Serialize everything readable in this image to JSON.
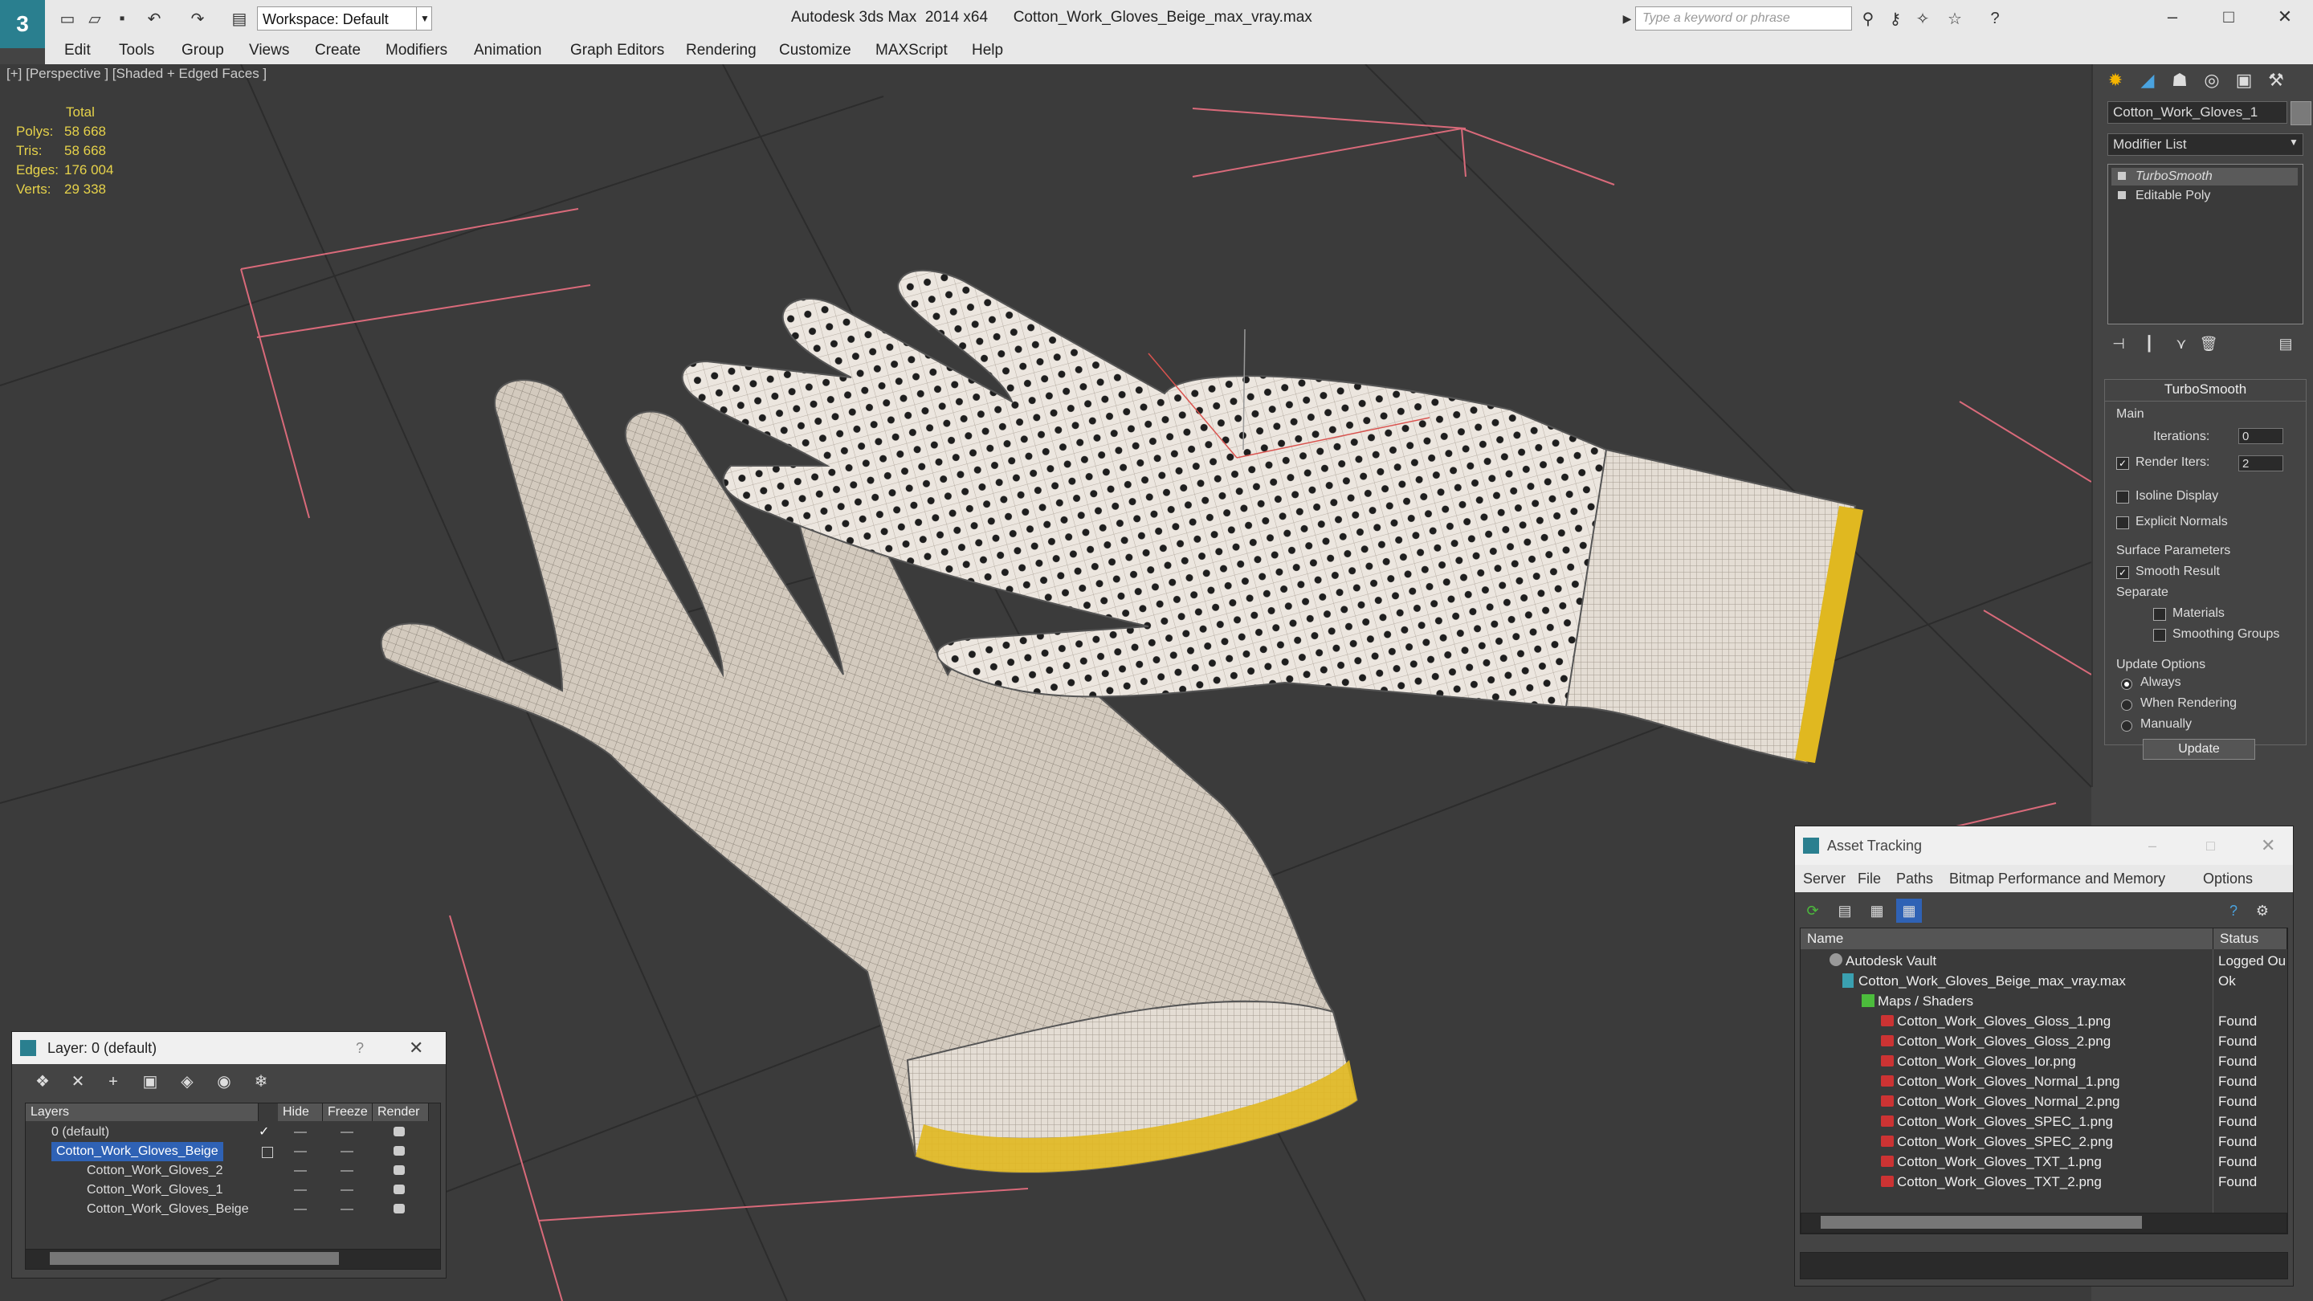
{
  "app": {
    "window_title": "Autodesk 3ds Max  2014 x64      Cotton_Work_Gloves_Beige_max_vray.max",
    "workspace": "Workspace: Default",
    "search_placeholder": "Type a keyword or phrase"
  },
  "menu": [
    "Edit",
    "Tools",
    "Group",
    "Views",
    "Create",
    "Modifiers",
    "Animation",
    "Graph Editors",
    "Rendering",
    "Customize",
    "MAXScript",
    "Help"
  ],
  "viewport": {
    "label": "[+] [Perspective ] [Shaded + Edged Faces ]",
    "stats": {
      "header": "Total",
      "rows": [
        {
          "label": "Polys:",
          "value": "58 668"
        },
        {
          "label": "Tris:",
          "value": "58 668"
        },
        {
          "label": "Edges:",
          "value": "176 004"
        },
        {
          "label": "Verts:",
          "value": "29 338"
        }
      ]
    }
  },
  "command_panel": {
    "object_name": "Cotton_Work_Gloves_1",
    "modifier_list": "Modifier List",
    "stack": [
      "TurboSmooth",
      "Editable Poly"
    ],
    "turbosmooth": {
      "title": "TurboSmooth",
      "main_label": "Main",
      "iterations_label": "Iterations:",
      "iterations_value": "0",
      "render_iters_label": "Render Iters:",
      "render_iters_value": "2",
      "render_iters_checked": true,
      "isoline_label": "Isoline Display",
      "explicit_normals_label": "Explicit Normals",
      "surface_params_label": "Surface Parameters",
      "smooth_result_label": "Smooth Result",
      "separate_label": "Separate",
      "materials_label": "Materials",
      "smoothing_groups_label": "Smoothing Groups",
      "update_options_label": "Update Options",
      "always_label": "Always",
      "when_rendering_label": "When Rendering",
      "manually_label": "Manually",
      "update_button": "Update"
    }
  },
  "layer_dialog": {
    "title": "Layer: 0 (default)",
    "help": "?",
    "columns": [
      "Layers",
      "Hide",
      "Freeze",
      "Render"
    ],
    "rows": [
      {
        "name": "0 (default)",
        "selected": false,
        "indent": 1
      },
      {
        "name": "Cotton_Work_Gloves_Beige",
        "selected": true,
        "indent": 1
      },
      {
        "name": "Cotton_Work_Gloves_2",
        "selected": false,
        "indent": 2
      },
      {
        "name": "Cotton_Work_Gloves_1",
        "selected": false,
        "indent": 2
      },
      {
        "name": "Cotton_Work_Gloves_Beige",
        "selected": false,
        "indent": 2
      }
    ]
  },
  "asset_dialog": {
    "title": "Asset Tracking",
    "menu": [
      "Server",
      "File",
      "Paths",
      "Bitmap Performance and Memory",
      "Options"
    ],
    "columns": [
      "Name",
      "Status"
    ],
    "rows": [
      {
        "name": "Autodesk Vault",
        "status": "Logged Ou",
        "icon": "vault-icon",
        "indent": 0
      },
      {
        "name": "Cotton_Work_Gloves_Beige_max_vray.max",
        "status": "Ok",
        "icon": "max-file-icon",
        "indent": 1
      },
      {
        "name": "Maps / Shaders",
        "status": "",
        "icon": "folder-icon",
        "indent": 2
      },
      {
        "name": "Cotton_Work_Gloves_Gloss_1.png",
        "status": "Found",
        "icon": "png-icon",
        "indent": 3
      },
      {
        "name": "Cotton_Work_Gloves_Gloss_2.png",
        "status": "Found",
        "icon": "png-icon",
        "indent": 3
      },
      {
        "name": "Cotton_Work_Gloves_Ior.png",
        "status": "Found",
        "icon": "png-icon",
        "indent": 3
      },
      {
        "name": "Cotton_Work_Gloves_Normal_1.png",
        "status": "Found",
        "icon": "png-icon",
        "indent": 3
      },
      {
        "name": "Cotton_Work_Gloves_Normal_2.png",
        "status": "Found",
        "icon": "png-icon",
        "indent": 3
      },
      {
        "name": "Cotton_Work_Gloves_SPEC_1.png",
        "status": "Found",
        "icon": "png-icon",
        "indent": 3
      },
      {
        "name": "Cotton_Work_Gloves_SPEC_2.png",
        "status": "Found",
        "icon": "png-icon",
        "indent": 3
      },
      {
        "name": "Cotton_Work_Gloves_TXT_1.png",
        "status": "Found",
        "icon": "png-icon",
        "indent": 3
      },
      {
        "name": "Cotton_Work_Gloves_TXT_2.png",
        "status": "Found",
        "icon": "png-icon",
        "indent": 3
      }
    ]
  },
  "colors": {
    "viewport_bg": "#3b3b3b",
    "stats_text": "#e6d24a",
    "selection": "#2f62b5",
    "glove": "#d8cfc4",
    "cuff_trim": "#e0b820",
    "safe_frame": "#d96a7a"
  }
}
